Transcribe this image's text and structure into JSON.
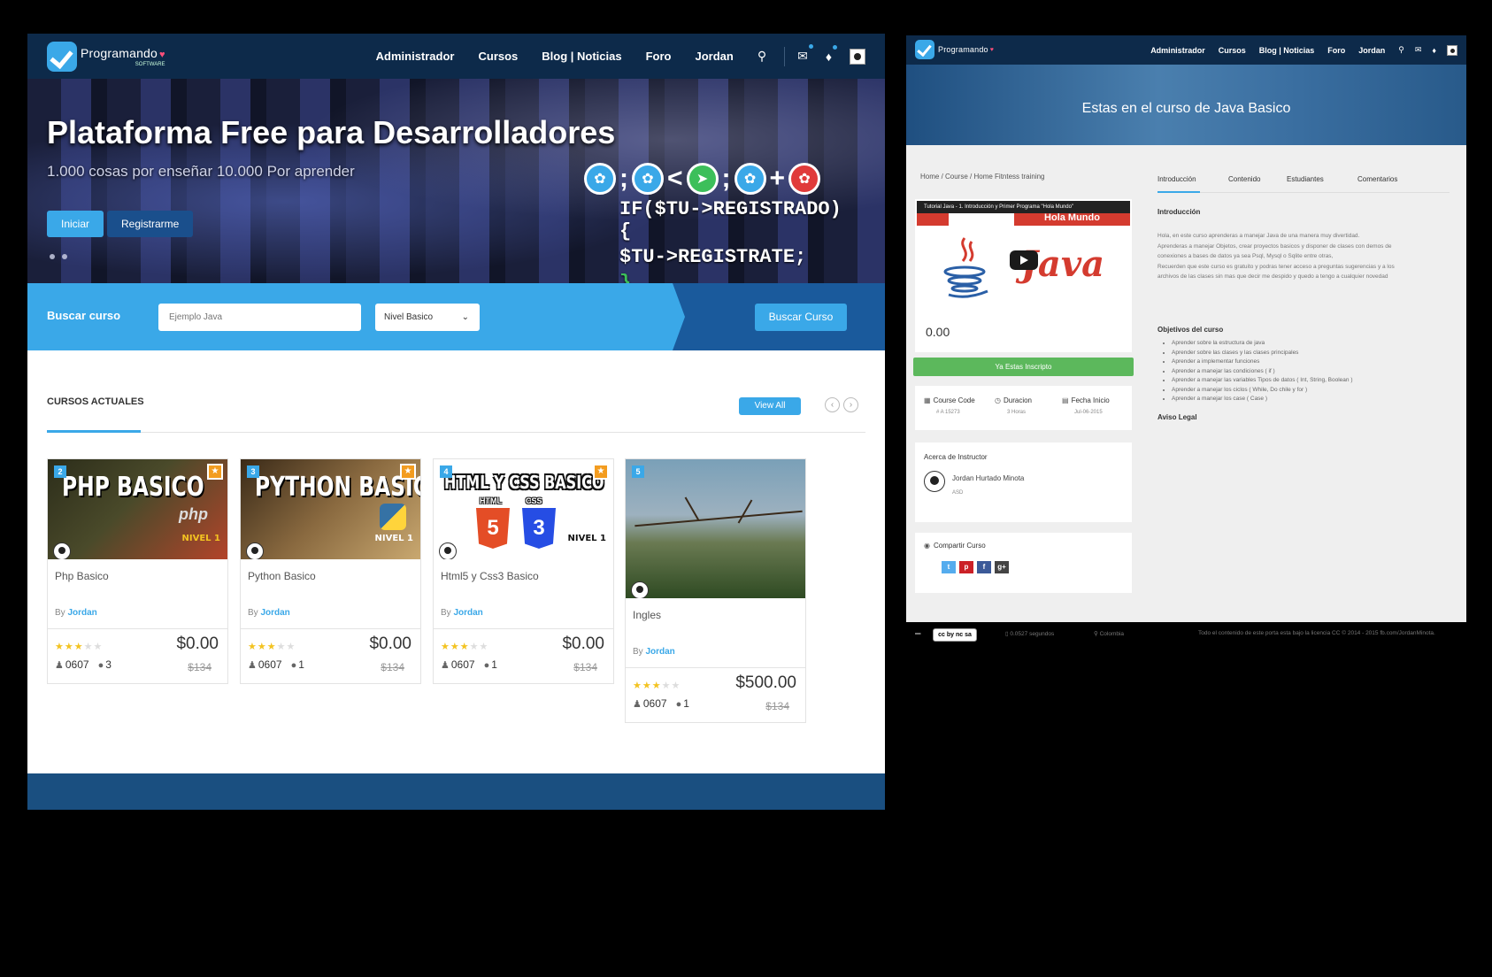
{
  "left": {
    "brand": {
      "name": "Programando",
      "sub": "SOFTWARE"
    },
    "nav": [
      "Administrador",
      "Cursos",
      "Blog | Noticias",
      "Foro",
      "Jordan"
    ],
    "hero": {
      "title": "Plataforma Free para Desarrolladores",
      "subtitle": "1.000 cosas por enseñar 10.000 Por aprender",
      "btn_primary": "Iniciar",
      "btn_secondary": "Registrarme",
      "code_line1": "IF($TU->REGISTRADO){",
      "code_line2": "$TU->REGISTRATE;",
      "code_line3": "}"
    },
    "search": {
      "label": "Buscar curso",
      "placeholder": "Ejemplo Java",
      "level": "Nivel Basico",
      "button": "Buscar Curso"
    },
    "section": {
      "title": "CURSOS ACTUALES",
      "view_all": "View All"
    },
    "courses": [
      {
        "num": "2",
        "thumb_title": "PHP BASICO",
        "logo": "php",
        "level": "NIVEL 1",
        "name": "Php Basico",
        "by": "By",
        "author": "Jordan",
        "rating": 3,
        "price": "$0.00",
        "old_price": "$134",
        "students": "0607",
        "comments": "3"
      },
      {
        "num": "3",
        "thumb_title": "PYTHON BASICO",
        "level": "NIVEL 1",
        "name": "Python Basico",
        "by": "By",
        "author": "Jordan",
        "rating": 3,
        "price": "$0.00",
        "old_price": "$134",
        "students": "0607",
        "comments": "1"
      },
      {
        "num": "4",
        "thumb_title": "HTML Y CSS BASICO",
        "sub_html": "HTML",
        "sub_css": "CSS",
        "badge_html": "5",
        "badge_css": "3",
        "level": "NIVEL 1",
        "name": "Html5 y Css3 Basico",
        "by": "By",
        "author": "Jordan",
        "rating": 3,
        "price": "$0.00",
        "old_price": "$134",
        "students": "0607",
        "comments": "1"
      },
      {
        "num": "5",
        "name": "Ingles",
        "by": "By",
        "author": "Jordan",
        "rating": 3,
        "price": "$500.00",
        "old_price": "$134",
        "students": "0607",
        "comments": "1"
      }
    ]
  },
  "right": {
    "brand": {
      "name": "Programando"
    },
    "nav": [
      "Administrador",
      "Cursos",
      "Blog | Noticias",
      "Foro",
      "Jordan"
    ],
    "hero_title": "Estas en el curso de Java Basico",
    "breadcrumb": "Home / Course / Home Fitntess training",
    "video": {
      "bar_title": "Tutorial Java - 1. Introducción y Primer Programa \"Hola Mundo\"",
      "banner": "Hola Mundo",
      "logo_word": "Java",
      "price": "0.00"
    },
    "enrolled": "Ya Estas Inscripto",
    "info": [
      {
        "label": "Course Code",
        "value": "# A 15273"
      },
      {
        "label": "Duracion",
        "value": "3 Horas"
      },
      {
        "label": "Fecha Inicio",
        "value": "Jul-06-2015"
      }
    ],
    "instructor": {
      "title": "Acerca de Instructor",
      "name": "Jordan Hurtado Minota",
      "sub": "ASD"
    },
    "share": {
      "title": "Compartir Curso",
      "buttons": [
        "t",
        "p",
        "f",
        "g+"
      ]
    },
    "tabs": [
      "Introducción",
      "Contenido",
      "Estudiantes",
      "Comentarios"
    ],
    "intro_heading": "Introducción",
    "intro_lines": [
      "Hola, en este curso aprenderas a manejar Java de una manera muy divertidad.",
      "Aprenderas a manejar Objetos, crear proyectos basicos y disponer de clases con demos de",
      "conexiones a bases de datos ya sea Psql, Mysql o Sqlite entre otras,",
      "Recuerden que este curso es gratuito y podras tener acceso a preguntas sugerencias y a los",
      "archivos de las clases sin mas que decir me despido y quedo a tengo a cualquier novedad"
    ],
    "objectives_heading": "Objetivos del curso",
    "objectives": [
      "Aprender sobre la estructura de java",
      "Aprender sobre las clases y las clases principales",
      "Aprender a implementar funciones",
      "Aprender a manejar las condiciones ( if )",
      "Aprender a manejar las variables Tipos de datos ( Int, String, Boolean )",
      "Aprender a manejar los ciclos ( While, Do chile y for )",
      "Aprender a manejar los case ( Case )"
    ],
    "legal_heading": "Aviso Legal",
    "footer": {
      "cc": "cc by nc sa",
      "time": "0.0527 segundos",
      "location": "Colombia",
      "license": "Todo el contenido de este porta esta bajo la licencia CC © 2014 - 2015 fb.com/JordanMinota."
    }
  },
  "colors": {
    "accent": "#3aa8e8",
    "navy": "#0d2a4a",
    "star": "#f3c321",
    "fav": "#f39c1f",
    "success": "#5cb85c"
  }
}
